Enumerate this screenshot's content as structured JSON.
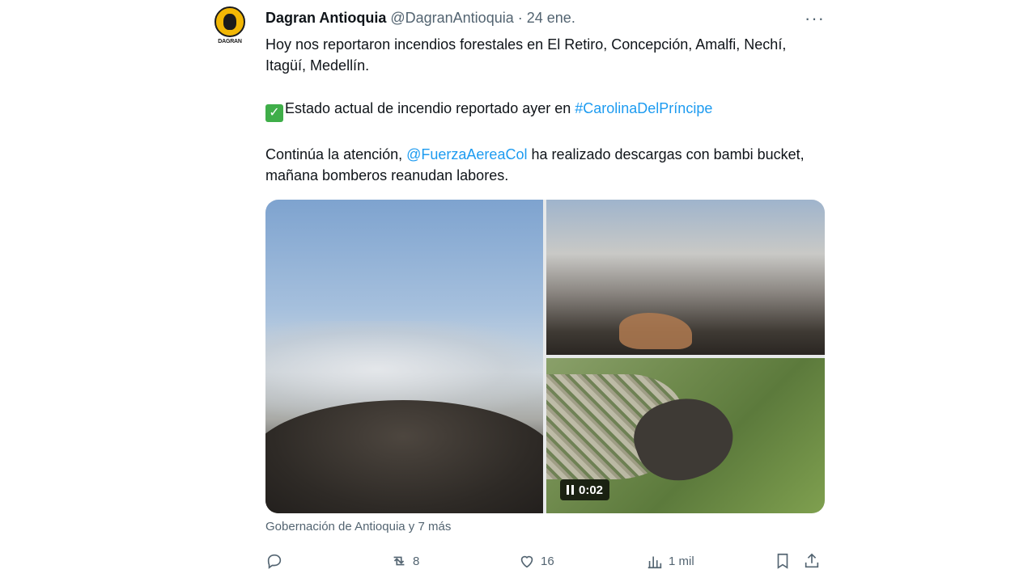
{
  "tweet": {
    "author_name": "Dagran Antioquia",
    "handle": "@DagranAntioquia",
    "separator": "·",
    "date": "24 ene.",
    "avatar_brand": "DAGRAN",
    "more_label": "···",
    "line1": "Hoy nos reportaron incendios forestales en El Retiro, Concepción, Amalfi, Nechí, Itagüí, Medellín.",
    "check_glyph": "✓",
    "line2_text": "Estado actual de incendio reportado ayer en ",
    "line2_hashtag": "#CarolinaDelPríncipe",
    "line3_prefix": "Continúa la atención, ",
    "line3_mention": "@FuerzaAereaCol",
    "line3_suffix": " ha realizado descargas con bambi bucket, mañana bomberos reanudan labores.",
    "video_time": "0:02",
    "tagged_text": "Gobernación de Antioquia y 7 más"
  },
  "actions": {
    "reply_count": "",
    "retweet_count": "8",
    "like_count": "16",
    "views_count": "1 mil"
  },
  "colors": {
    "link": "#1d9bf0",
    "muted": "#536471",
    "text": "#0f1419"
  },
  "icons": [
    "reply-icon",
    "retweet-icon",
    "like-icon",
    "views-icon",
    "bookmark-icon",
    "share-icon",
    "pause-icon",
    "more-icon",
    "check-icon"
  ]
}
